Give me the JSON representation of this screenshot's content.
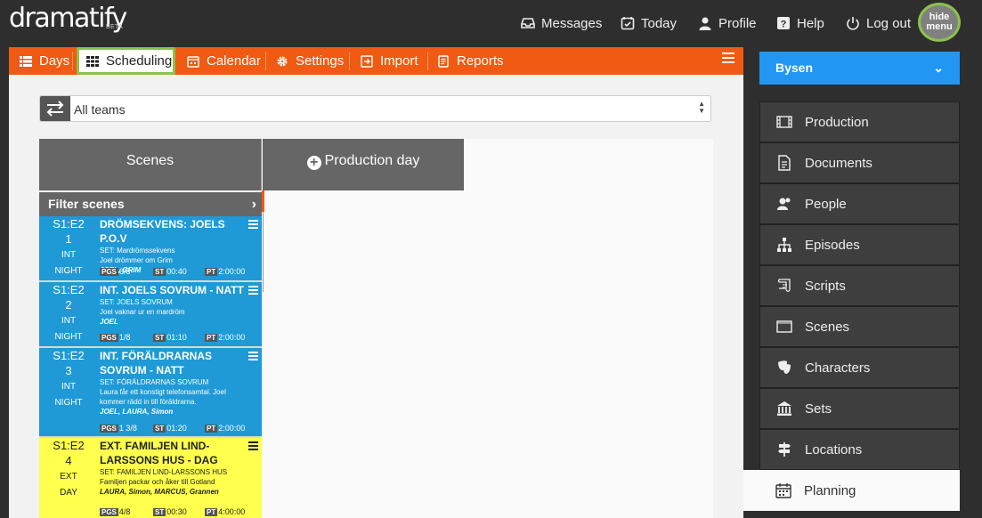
{
  "header": {
    "logo": "dramatify",
    "logo_badge": "BETA",
    "nav": [
      "Messages",
      "Today",
      "Profile",
      "Help",
      "Log out"
    ],
    "hide_menu": "hide\nmenu"
  },
  "tabs": [
    "Days",
    "Scheduling",
    "Calendar",
    "Settings",
    "Import",
    "Reports"
  ],
  "active_tab": "Scheduling",
  "team_select": {
    "value": "All teams"
  },
  "board": {
    "scenes_header": "Scenes",
    "production_day": "Production day",
    "filter_label": "Filter scenes"
  },
  "scenes": [
    {
      "code": "S1:E2",
      "num": "1",
      "ie": "INT",
      "tod": "NIGHT",
      "title": "DRÖMSEKVENS: JOELS P.O.V",
      "set": "SET: Mardrömssekvens",
      "desc": "Joel drömmer om Grim",
      "chars": "JOEL, GRIM",
      "pgs": "6/8",
      "st": "00:40",
      "pt": "2:00:00",
      "color": "blue"
    },
    {
      "code": "S1:E2",
      "num": "2",
      "ie": "INT",
      "tod": "NIGHT",
      "title": "INT. JOELS SOVRUM - NATT",
      "set": "SET: JOELS SOVRUM",
      "desc": "Joel vaknar ur en mardröm",
      "chars": "JOEL",
      "pgs": "1/8",
      "st": "01:10",
      "pt": "2:00:00",
      "color": "blue"
    },
    {
      "code": "S1:E2",
      "num": "3",
      "ie": "INT",
      "tod": "NIGHT",
      "title": "INT. FÖRÄLDRARNAS SOVRUM - NATT",
      "set": "SET: FÖRÄLDRARNAS SOVRUM",
      "desc": "Laura får ett konstigt telefonsamtal. Joel kommer rädd in till föräldrarna.",
      "chars": "JOEL, LAURA, Simon",
      "pgs": "1 3/8",
      "st": "01:20",
      "pt": "2:00:00",
      "color": "blue"
    },
    {
      "code": "S1:E2",
      "num": "4",
      "ie": "EXT",
      "tod": "DAY",
      "title": "EXT. FAMILJEN LIND-LARSSONS HUS - DAG",
      "set": "SET: FAMILJEN LIND-LARSSONS HUS",
      "desc": "Familjen packar och åker till Gotland",
      "chars": "LAURA, Simon, MARCUS, Grannen",
      "pgs": "4/8",
      "st": "00:30",
      "pt": "4:00:00",
      "color": "yellow"
    }
  ],
  "stat_labels": {
    "pgs": "PGS",
    "st": "ST",
    "pt": "PT"
  },
  "sidebar": {
    "project": "Bysen",
    "items": [
      "Production",
      "Documents",
      "People",
      "Episodes",
      "Scripts",
      "Scenes",
      "Characters",
      "Sets",
      "Locations",
      "Planning"
    ],
    "active": "Planning"
  },
  "colors": {
    "accent": "#f05a12",
    "scene_blue": "#1f9ad6",
    "scene_yellow": "#ffff4d",
    "project": "#2196f3",
    "highlight": "#8bc34a"
  }
}
